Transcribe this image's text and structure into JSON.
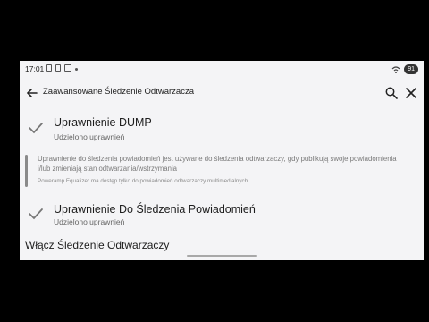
{
  "status": {
    "time": "17:01",
    "battery": "91"
  },
  "appbar": {
    "title": "Zaawansowane Śledzenie Odtwarzacza"
  },
  "items": [
    {
      "title": "Uprawnienie DUMP",
      "subtitle": "Udzielono uprawnień"
    },
    {
      "title": "Uprawnienie Do Śledzenia Powiadomień",
      "subtitle": "Udzielono uprawnień"
    }
  ],
  "info": {
    "text": "Uprawnienie do śledzenia powiadomień jest używane do śledzenia odtwarzaczy, gdy publikują swoje powiadomienia i/lub zmieniają stan odtwarzania/wstrzymania",
    "note": "Poweramp Equalizer ma dostęp tylko do powiadomień odtwarzaczy multimedialnych"
  },
  "section": {
    "title": "Włącz Śledzenie Odtwarzaczy"
  },
  "icons": {
    "back": "arrow-back-icon",
    "search": "search-icon",
    "close": "close-icon",
    "check": "check-icon"
  }
}
